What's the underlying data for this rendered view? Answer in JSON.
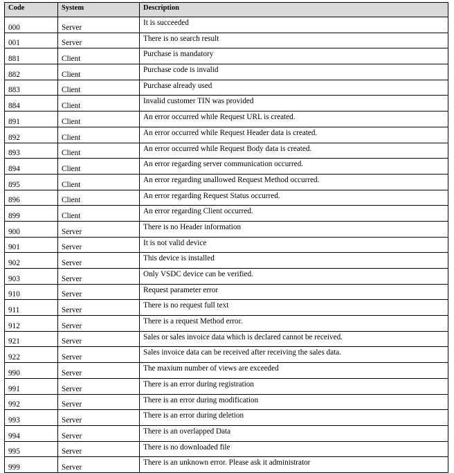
{
  "headers": {
    "code": "Code",
    "system": "System",
    "description": "Description"
  },
  "rows": [
    {
      "code": "000",
      "system": "Server",
      "description": "It is succeeded"
    },
    {
      "code": "001",
      "system": "Server",
      "description": "There is no search result"
    },
    {
      "code": "881",
      "system": "Client",
      "description": "Purchase is mandatory"
    },
    {
      "code": "882",
      "system": "Client",
      "description": "Purchase code is invalid"
    },
    {
      "code": "883",
      "system": "Client",
      "description": "Purchase already used"
    },
    {
      "code": "884",
      "system": "Client",
      "description": "Invalid customer TIN was provided"
    },
    {
      "code": "891",
      "system": "Client",
      "description": "An error occurred while Request URL is created."
    },
    {
      "code": "892",
      "system": "Client",
      "description": "An error occurred while Request Header data is created."
    },
    {
      "code": "893",
      "system": "Client",
      "description": "An error occurred while Request Body data is created."
    },
    {
      "code": "894",
      "system": "Client",
      "description": "An error regarding server communication occurred."
    },
    {
      "code": "895",
      "system": "Client",
      "description": "An error regarding unallowed Request Method occurred."
    },
    {
      "code": "896",
      "system": "Client",
      "description": "An error regarding Request Status occurred."
    },
    {
      "code": "899",
      "system": "Client",
      "description": "An error regarding Client occurred."
    },
    {
      "code": "900",
      "system": "Server",
      "description": "There is no Header information"
    },
    {
      "code": "901",
      "system": "Server",
      "description": "It is not valid device"
    },
    {
      "code": "902",
      "system": "Server",
      "description": "This device is installed"
    },
    {
      "code": "903",
      "system": "Server",
      "description": "Only VSDC device can be verified."
    },
    {
      "code": "910",
      "system": "Server",
      "description": "Request parameter error"
    },
    {
      "code": "911",
      "system": "Server",
      "description": "There is no request full text"
    },
    {
      "code": "912",
      "system": "Server",
      "description": "There is a request Method error."
    },
    {
      "code": "921",
      "system": "Server",
      "description": "Sales or sales invoice data which is declared cannot be received."
    },
    {
      "code": "922",
      "system": "Server",
      "description": "Sales invoice data can be received after receiving the sales data."
    },
    {
      "code": "990",
      "system": "Server",
      "description": "The maxium number of views are exceeded"
    },
    {
      "code": "991",
      "system": "Server",
      "description": "There is an error during registration"
    },
    {
      "code": "992",
      "system": "Server",
      "description": "There is an error during modification"
    },
    {
      "code": "993",
      "system": "Server",
      "description": "There is an error during deletion"
    },
    {
      "code": "994",
      "system": "Server",
      "description": "There is an overlapped Data"
    },
    {
      "code": "995",
      "system": "Server",
      "description": "There is no downloaded file"
    },
    {
      "code": "999",
      "system": "Server",
      "description": "There is an unknown error. Please ask it administrator"
    }
  ]
}
